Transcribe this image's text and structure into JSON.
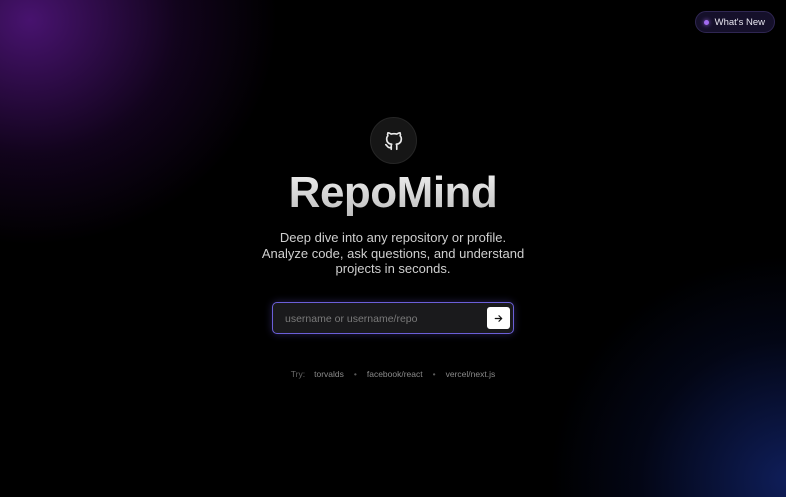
{
  "header": {
    "whats_new_label": "What's New"
  },
  "hero": {
    "logo_icon": "github-icon",
    "title": "RepoMind",
    "subtitle": "Deep dive into any repository or profile. Analyze code, ask questions, and understand projects in seconds."
  },
  "search": {
    "placeholder": "username or username/repo",
    "value": "",
    "submit_icon": "arrow-right-icon"
  },
  "suggestions": {
    "label": "Try:",
    "items": [
      "torvalds",
      "facebook/react",
      "vercel/next.js"
    ],
    "separator": "•"
  },
  "colors": {
    "accent": "#6b5fd8",
    "dot": "#a26bf0",
    "background": "#000000"
  }
}
